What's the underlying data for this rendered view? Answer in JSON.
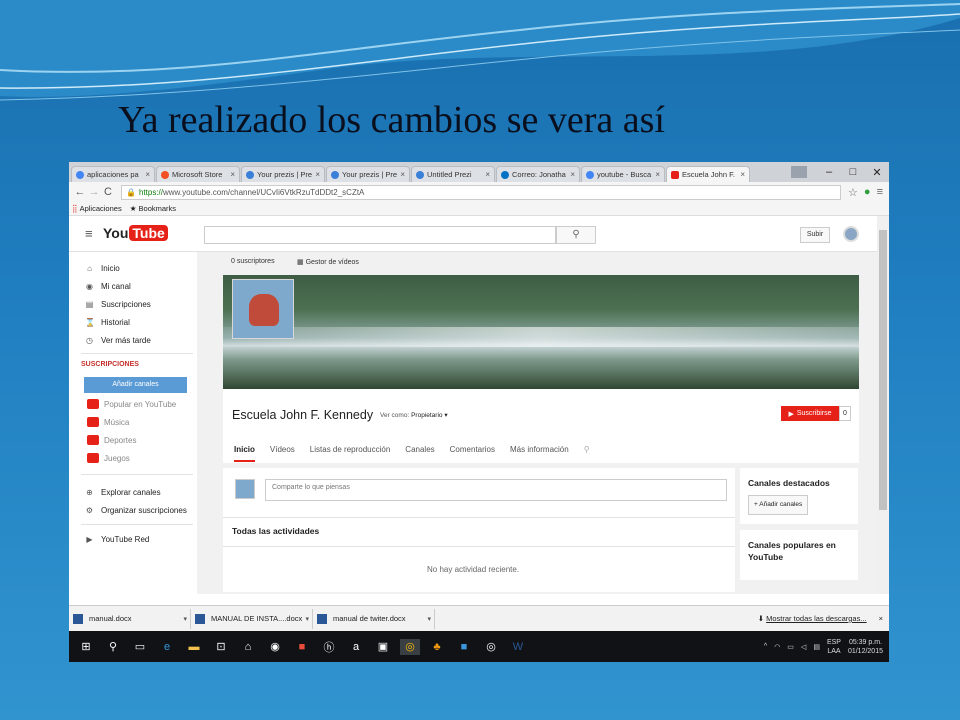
{
  "slide": {
    "title": "Ya realizado los cambios se vera así"
  },
  "browser": {
    "tabs": [
      {
        "label": "aplicaciones pa",
        "color": "#4285f4",
        "active": false
      },
      {
        "label": "Microsoft Store",
        "color": "#f25022",
        "active": false
      },
      {
        "label": "Your prezis | Pre",
        "color": "#3a7fd8",
        "active": false
      },
      {
        "label": "Your prezis | Pre",
        "color": "#3a7fd8",
        "active": false
      },
      {
        "label": "Untitled Prezi",
        "color": "#3a7fd8",
        "active": false
      },
      {
        "label": "Correo: Jonatha",
        "color": "#0072c6",
        "active": false
      },
      {
        "label": "youtube - Busca",
        "color": "#4285f4",
        "active": false
      },
      {
        "label": "Escuela John F. K",
        "color": "#e62117",
        "active": true
      }
    ],
    "tab_close": "×",
    "window_controls": {
      "minimize": "–",
      "maximize": "□",
      "close": "✕"
    },
    "url_protocol": "https://",
    "url_rest": "www.youtube.com/channel/UCvIi6VtkRzuTdDDt2_sCZtA",
    "bookmarks": {
      "apps": "Aplicaciones",
      "bookmarks": "Bookmarks"
    }
  },
  "youtube": {
    "logo_you": "You",
    "logo_tube": "Tube",
    "search_icon": "search-icon",
    "upload_label": "Subir",
    "sidebar": {
      "items": [
        {
          "label": "Inicio",
          "icon": "home-icon"
        },
        {
          "label": "Mi canal",
          "icon": "user-icon"
        },
        {
          "label": "Suscripciones",
          "icon": "subscriptions-icon"
        },
        {
          "label": "Historial",
          "icon": "history-icon"
        },
        {
          "label": "Ver más tarde",
          "icon": "clock-icon"
        }
      ],
      "subs_heading": "SUSCRIPCIONES",
      "add_channels": "Añadir canales",
      "subs": [
        "Popular en YouTube",
        "Música",
        "Deportes",
        "Juegos"
      ],
      "explore": "Explorar canales",
      "organize": "Organizar suscripciones",
      "red": "YouTube Red"
    },
    "channel": {
      "subscribers": "0 suscriptores",
      "video_manager": "Gestor de vídeos",
      "name": "Escuela John F. Kennedy",
      "view_as_label": "Ver como:",
      "view_as_value": "Propietario ▾",
      "subscribe": "Suscribirse",
      "sub_count": "0",
      "tabs": [
        "Inicio",
        "Vídeos",
        "Listas de reproducción",
        "Canales",
        "Comentarios",
        "Más información"
      ],
      "post_placeholder": "Comparte lo que piensas",
      "activities_title": "Todas las actividades",
      "no_activity": "No hay actividad reciente.",
      "featured_title": "Canales destacados",
      "featured_add": "+ Añadir canales",
      "popular_title": "Canales populares en YouTube"
    }
  },
  "downloads": {
    "files": [
      "manual.docx",
      "MANUAL DE INSTA....docx",
      "manual de twiter.docx"
    ],
    "show_all": "Mostrar todas las descargas...",
    "close": "×"
  },
  "taskbar": {
    "lang": "ESP",
    "lang2": "LAA",
    "time": "05:39 p.m.",
    "date": "01/12/2015"
  }
}
